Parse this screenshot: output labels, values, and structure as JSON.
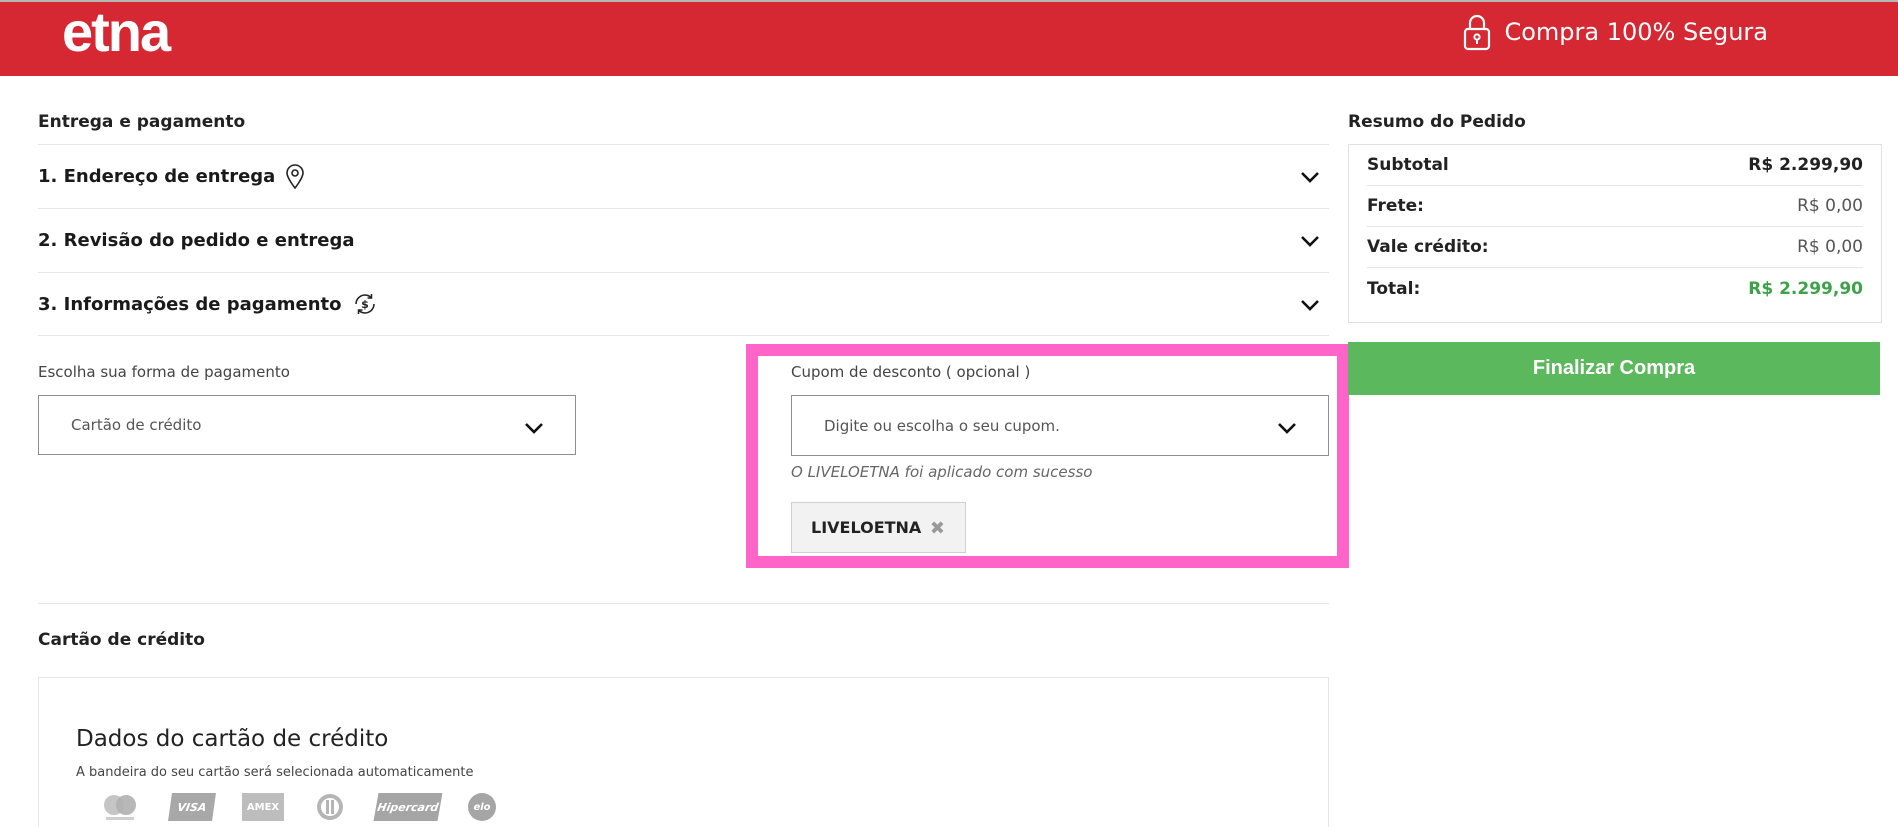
{
  "header": {
    "logo": "etna",
    "secure_label": "Compra 100% Segura"
  },
  "main": {
    "section_title": "Entrega e pagamento",
    "steps": [
      {
        "label": "1. Endereço de entrega",
        "icon": "map-pin-icon"
      },
      {
        "label": "2. Revisão do pedido e entrega"
      },
      {
        "label": "3. Informações de pagamento",
        "icon": "payment-cycle-icon"
      }
    ],
    "payment_method": {
      "label": "Escolha sua forma de pagamento",
      "selected": "Cartão de crédito"
    },
    "coupon": {
      "label": "Cupom de desconto ( opcional )",
      "placeholder": "Digite ou escolha o seu cupom.",
      "success_message": "O LIVELOETNA foi aplicado com sucesso",
      "applied_code": "LIVELOETNA",
      "highlight_color": "#ff65c8"
    },
    "card_section": {
      "title": "Cartão de crédito",
      "box_title": "Dados do cartão de crédito",
      "hint": "A bandeira do seu cartão será selecionada automaticamente",
      "brands": [
        {
          "icon": "mastercard-icon",
          "text": ""
        },
        {
          "icon": "visa-icon",
          "text": "VISA"
        },
        {
          "icon": "amex-icon",
          "text": "AMEX"
        },
        {
          "icon": "diners-icon",
          "text": ""
        },
        {
          "icon": "hipercard-icon",
          "text": "Hipercard"
        },
        {
          "icon": "elo-icon",
          "text": "elo"
        }
      ]
    }
  },
  "summary": {
    "title": "Resumo do Pedido",
    "rows": [
      {
        "label": "Subtotal",
        "value": "R$ 2.299,90"
      },
      {
        "label": "Frete:",
        "value": "R$ 0,00"
      },
      {
        "label": "Vale crédito:",
        "value": "R$ 0,00"
      },
      {
        "label": "Total:",
        "value": "R$ 2.299,90"
      }
    ],
    "finalize_label": "Finalizar Compra",
    "colors": {
      "total": "#3ea24a",
      "button": "#5cb85c"
    }
  },
  "colors": {
    "brand": "#d62832"
  }
}
